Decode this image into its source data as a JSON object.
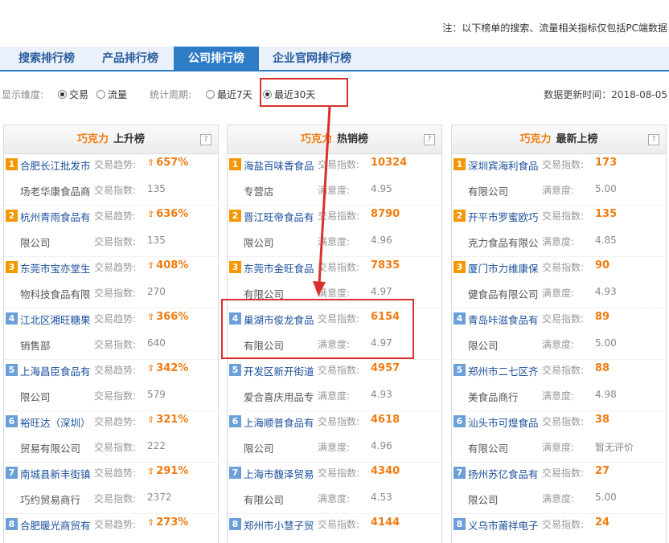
{
  "note": "注：以下榜单的搜索、流量相关指标仅包括PC端数据",
  "tabs": [
    {
      "label": "搜索排行榜",
      "active": false
    },
    {
      "label": "产品排行榜",
      "active": false
    },
    {
      "label": "公司排行榜",
      "active": true
    },
    {
      "label": "企业官网排行榜",
      "active": false
    }
  ],
  "filters": {
    "dimension_label": "显示维度:",
    "dimension_options": [
      {
        "label": "交易",
        "selected": true
      },
      {
        "label": "流量",
        "selected": false
      }
    ],
    "period_label": "统计周期:",
    "period_options": [
      {
        "label": "最近7天",
        "selected": false
      },
      {
        "label": "最近30天",
        "selected": true
      }
    ],
    "update_text": "数据更新时间：2018-08-05"
  },
  "colors": {
    "accent": "#2e7bc6",
    "brand_orange": "#f07c12",
    "highlight_red": "#d9302c"
  },
  "panels": [
    {
      "brand": "巧克力",
      "title": "上升榜",
      "help": "?",
      "items": [
        {
          "rank": "1",
          "name1": "合肥长江批发市",
          "name2": "场老华康食品商",
          "label1": "交易趋势:",
          "value1": "657%",
          "label2": "交易指数:",
          "value2": "135",
          "trend": "up"
        },
        {
          "rank": "2",
          "name1": "杭州青雨食品有",
          "name2": "限公司",
          "label1": "交易趋势:",
          "value1": "636%",
          "label2": "交易指数:",
          "value2": "135",
          "trend": "up"
        },
        {
          "rank": "3",
          "name1": "东莞市宝亦堂生",
          "name2": "物科技食品有限",
          "label1": "交易趋势:",
          "value1": "408%",
          "label2": "交易指数:",
          "value2": "270",
          "trend": "up"
        },
        {
          "rank": "4",
          "name1": "江北区湘旺糖果",
          "name2": "销售部",
          "label1": "交易趋势:",
          "value1": "366%",
          "label2": "交易指数:",
          "value2": "640",
          "trend": "up"
        },
        {
          "rank": "5",
          "name1": "上海昌臣食品有",
          "name2": "限公司",
          "label1": "交易趋势:",
          "value1": "342%",
          "label2": "交易指数:",
          "value2": "579",
          "trend": "up"
        },
        {
          "rank": "6",
          "name1": "裕旺达（深圳）",
          "name2": "贸易有限公司",
          "label1": "交易趋势:",
          "value1": "321%",
          "label2": "交易指数:",
          "value2": "222",
          "trend": "up"
        },
        {
          "rank": "7",
          "name1": "南城县新丰街镇",
          "name2": "巧约贸易商行",
          "label1": "交易趋势:",
          "value1": "291%",
          "label2": "交易指数:",
          "value2": "2372",
          "trend": "up"
        },
        {
          "rank": "8",
          "name1": "合肥暖光商贸有",
          "name2": "",
          "label1": "交易趋势:",
          "value1": "273%",
          "label2": "",
          "value2": "",
          "trend": "up"
        }
      ]
    },
    {
      "brand": "巧克力",
      "title": "热销榜",
      "help": "?",
      "items": [
        {
          "rank": "1",
          "name1": "海盐百味香食品",
          "name2": "专营店",
          "label1": "交易指数:",
          "value1": "10324",
          "label2": "满意度:",
          "value2": "4.95",
          "trend": ""
        },
        {
          "rank": "2",
          "name1": "晋江旺帝食品有",
          "name2": "限公司",
          "label1": "交易指数:",
          "value1": "8790",
          "label2": "满意度:",
          "value2": "4.96",
          "trend": ""
        },
        {
          "rank": "3",
          "name1": "东莞市金旺食品",
          "name2": "有限公司",
          "label1": "交易指数:",
          "value1": "7835",
          "label2": "满意度:",
          "value2": "4.97",
          "trend": ""
        },
        {
          "rank": "4",
          "name1": "巢湖市俊龙食品",
          "name2": "有限公司",
          "label1": "交易指数:",
          "value1": "6154",
          "label2": "满意度:",
          "value2": "4.97",
          "trend": ""
        },
        {
          "rank": "5",
          "name1": "开发区新开街道",
          "name2": "爱合喜庆用品专",
          "label1": "交易指数:",
          "value1": "4957",
          "label2": "满意度:",
          "value2": "4.93",
          "trend": ""
        },
        {
          "rank": "6",
          "name1": "上海顺普食品有",
          "name2": "限公司",
          "label1": "交易指数:",
          "value1": "4618",
          "label2": "满意度:",
          "value2": "4.96",
          "trend": ""
        },
        {
          "rank": "7",
          "name1": "上海市馥泽贸易",
          "name2": "有限公司",
          "label1": "交易指数:",
          "value1": "4340",
          "label2": "满意度:",
          "value2": "4.53",
          "trend": ""
        },
        {
          "rank": "8",
          "name1": "郑州市小慧子贸",
          "name2": "",
          "label1": "交易指数:",
          "value1": "4144",
          "label2": "",
          "value2": "",
          "trend": ""
        }
      ]
    },
    {
      "brand": "巧克力",
      "title": "最新上榜",
      "help": "?",
      "items": [
        {
          "rank": "1",
          "name1": "深圳宾海利食品",
          "name2": "有限公司",
          "label1": "交易指数:",
          "value1": "173",
          "label2": "满意度:",
          "value2": "5.00",
          "trend": ""
        },
        {
          "rank": "2",
          "name1": "开平市罗蜜欧巧",
          "name2": "克力食品有限公",
          "label1": "交易指数:",
          "value1": "135",
          "label2": "满意度:",
          "value2": "4.85",
          "trend": ""
        },
        {
          "rank": "3",
          "name1": "厦门市力维康保",
          "name2": "健食品有限公司",
          "label1": "交易指数:",
          "value1": "90",
          "label2": "满意度:",
          "value2": "4.93",
          "trend": ""
        },
        {
          "rank": "4",
          "name1": "青岛咔滋食品有",
          "name2": "限公司",
          "label1": "交易指数:",
          "value1": "89",
          "label2": "满意度:",
          "value2": "5.00",
          "trend": ""
        },
        {
          "rank": "5",
          "name1": "郑州市二七区齐",
          "name2": "美食品商行",
          "label1": "交易指数:",
          "value1": "88",
          "label2": "满意度:",
          "value2": "4.98",
          "trend": ""
        },
        {
          "rank": "6",
          "name1": "汕头市可煌食品",
          "name2": "有限公司",
          "label1": "交易指数:",
          "value1": "38",
          "label2": "满意度:",
          "value2": "暂无评价",
          "trend": ""
        },
        {
          "rank": "7",
          "name1": "扬州苏亿食品有",
          "name2": "限公司",
          "label1": "交易指数:",
          "value1": "27",
          "label2": "满意度:",
          "value2": "5.00",
          "trend": ""
        },
        {
          "rank": "8",
          "name1": "义乌市莆祥电子",
          "name2": "",
          "label1": "交易指数:",
          "value1": "24",
          "label2": "",
          "value2": "",
          "trend": ""
        }
      ]
    }
  ]
}
